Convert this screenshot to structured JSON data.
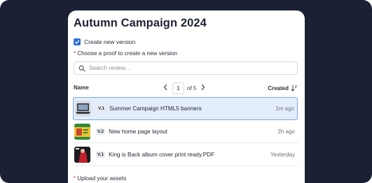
{
  "campaign": {
    "title": "Autumn Campaign 2024"
  },
  "options": {
    "create_new_version_label": "Create new version",
    "create_new_version_checked": true
  },
  "proof_select": {
    "required_marker": "*",
    "label": "Choose a proof to create a new version",
    "search_placeholder": "Search review..."
  },
  "table": {
    "col_name": "Name",
    "col_created": "Created",
    "pager": {
      "current": "1",
      "of_label": "of 5"
    },
    "rows": [
      {
        "version": "V.1",
        "name": "Summer Campaign HTML5 banners",
        "time": "1m ago",
        "selected": true,
        "thumb": "laptop-thumbnail"
      },
      {
        "version": "V.2",
        "name": "New home page layout",
        "time": "2h ago",
        "selected": false,
        "thumb": "webpage-thumbnail"
      },
      {
        "version": "V.1",
        "name": "King is Back album cover print ready.PDF",
        "time": "Yesterday",
        "selected": false,
        "thumb": "album-cover-thumbnail"
      }
    ]
  },
  "upload": {
    "required_marker": "*",
    "label": "Upload your assets"
  },
  "colors": {
    "accent": "#2f6fd6",
    "selected_row_bg": "#e3edfb",
    "frame_bg": "#1c2034",
    "required": "#d93838"
  }
}
